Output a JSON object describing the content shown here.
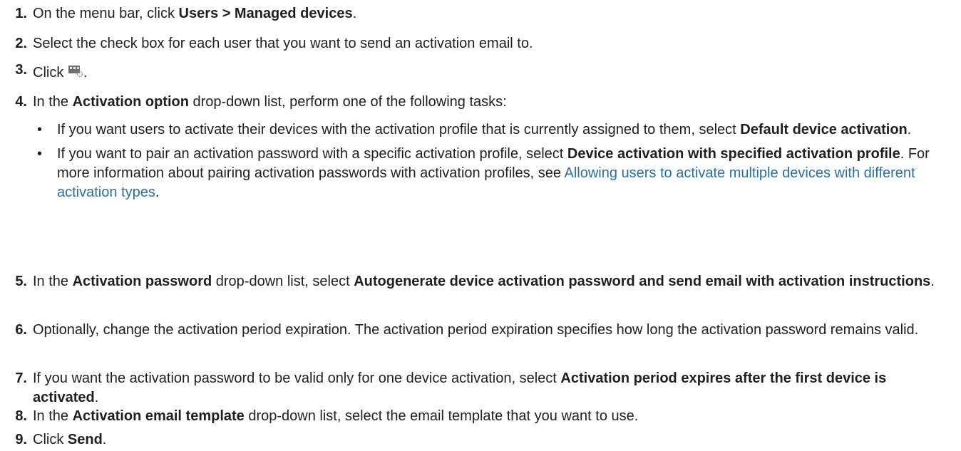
{
  "steps": [
    {
      "num": "1.",
      "pre": "On the menu bar, click ",
      "bold": "Users > Managed devices",
      "post": "."
    },
    {
      "num": "2.",
      "text": "Select the check box for each user that you want to send an activation email to."
    },
    {
      "num": "3.",
      "pre": "Click ",
      "post": ".",
      "icon": "send-activation-email-icon"
    },
    {
      "num": "4.",
      "pre": "In the ",
      "bold": "Activation option",
      "post": " drop-down list, perform one of the following tasks:",
      "bullets": [
        {
          "pre": "If you want users to activate their devices with the activation profile that is currently assigned to them, select ",
          "bold": "Default device activation",
          "post": "."
        },
        {
          "pre": "If you want to pair an activation password with a specific activation profile, select ",
          "bold": "Device activation with specified activation profile",
          "mid": ". For more information about pairing activation passwords with activation profiles, see ",
          "link": "Allowing users to activate multiple devices with different activation types",
          "post": "."
        }
      ]
    },
    {
      "num": "5.",
      "pre": "In the ",
      "bold": "Activation password",
      "mid": " drop-down list, select ",
      "bold2": "Autogenerate device activation password and send email with activation instructions",
      "post": "."
    },
    {
      "num": "6.",
      "text": "Optionally, change the activation period expiration. The activation period expiration specifies how long the activation password remains valid."
    },
    {
      "num": "7.",
      "pre": "If you want the activation password to be valid only for one device activation, select ",
      "bold": "Activation period expires after the first device is activated",
      "post": "."
    },
    {
      "num": "8.",
      "pre": "In the ",
      "bold": "Activation email template",
      "post": " drop-down list, select the email template that you want to use."
    },
    {
      "num": "9.",
      "pre": "Click ",
      "bold": "Send",
      "post": "."
    }
  ]
}
